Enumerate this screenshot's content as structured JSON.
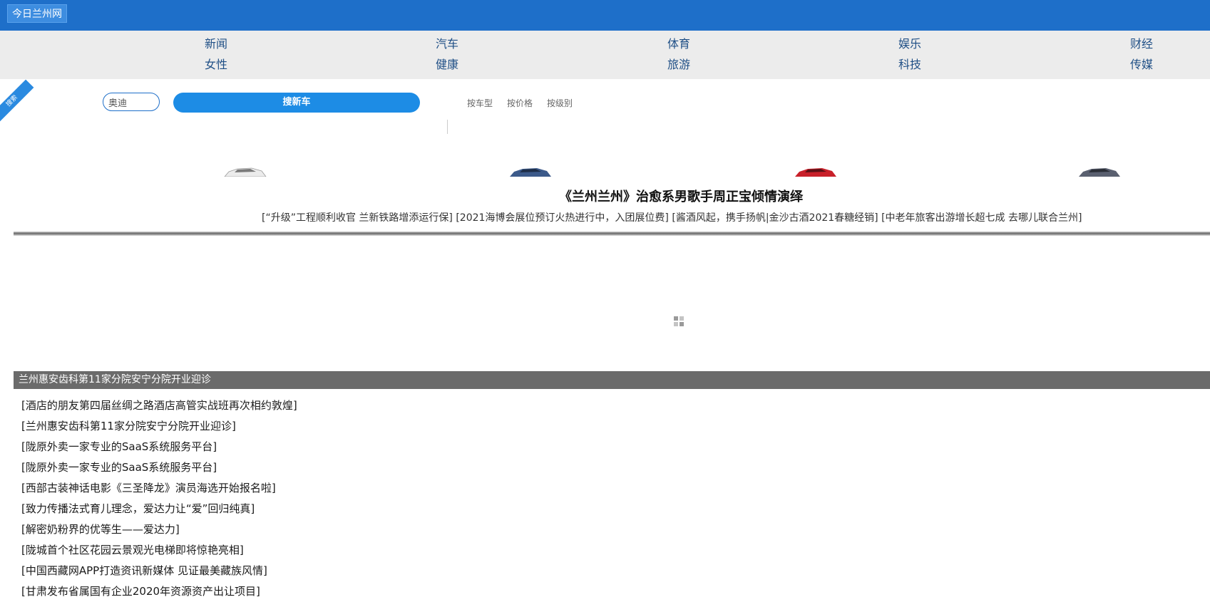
{
  "header": {
    "site_title": "今日兰州网"
  },
  "nav": {
    "row1": [
      "新闻",
      "汽车",
      "体育",
      "娱乐",
      "财经"
    ],
    "row2": [
      "女性",
      "健康",
      "旅游",
      "科技",
      "传媒"
    ]
  },
  "search": {
    "ribbon_label": "搜索",
    "brand_value": "奥迪",
    "button_label": "搜新车",
    "filter_tabs": [
      "按车型",
      "按价格",
      "按级别"
    ]
  },
  "cars": [
    {
      "icon": "white-car",
      "color": "#e8e8e8"
    },
    {
      "icon": "blue-car",
      "color": "#3c5a8a"
    },
    {
      "icon": "red-car",
      "color": "#c8202a"
    },
    {
      "icon": "silver-car",
      "color": "#5a6070"
    }
  ],
  "headline": {
    "title": "《兰州兰州》治愈系男歌手周正宝倾情演绎",
    "subheadlines": [
      "[“升级”工程顺利收官 兰新铁路增添运行保]",
      "[2021海博会展位预订火热进行中，入团展位费]",
      "[酱酒风起，携手扬帆|金沙古酒2021春糖经销]",
      "[中老年旅客出游增长超七成 去哪儿联合兰州]"
    ]
  },
  "featured": {
    "title": "兰州惠安齿科第11家分院安宁分院开业迎诊"
  },
  "news": [
    "[酒店的朋友第四届丝绸之路酒店高管实战班再次相约敦煌]",
    "[兰州惠安齿科第11家分院安宁分院开业迎诊]",
    "[陇原外卖一家专业的SaaS系统服务平台]",
    "[陇原外卖一家专业的SaaS系统服务平台]",
    "[西部古装神话电影《三圣降龙》演员海选开始报名啦]",
    "[致力传播法式育儿理念，爱达力让“爱”回归纯真]",
    "[解密奶粉界的优等生——爱达力]",
    "[陇城首个社区花园云景观光电梯即将惊艳亮相]",
    "[中国西藏网APP打造资讯新媒体 见证最美藏族风情]",
    "[甘肃发布省属国有企业2020年资源资产出让项目]"
  ]
}
